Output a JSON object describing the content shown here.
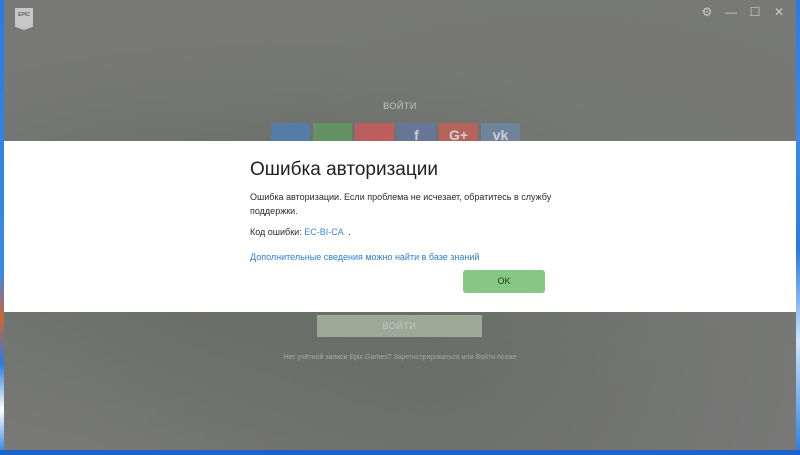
{
  "app": {
    "logo_text": "EPIC",
    "controls": [
      "⚙",
      "—",
      "☐",
      "✕"
    ]
  },
  "background": {
    "login_heading": "ВОЙТИ",
    "social_icons": [
      "playstation-icon",
      "xbox-icon",
      "nintendo-switch-icon",
      "facebook-icon",
      "google-plus-icon",
      "vk-icon"
    ],
    "social_labels": [
      "",
      "",
      "",
      "f",
      "G+",
      "vk"
    ],
    "social_colors": [
      "#1f67b8",
      "#3c8f3a",
      "#d9302c",
      "#3c5b98",
      "#cf3a2d",
      "#4d76a1"
    ],
    "login_button": "ВОЙТИ",
    "no_account": "Нет учётной записи Epic Games?",
    "signup_link": "Зарегистрироваться",
    "or": "или",
    "later_link": "Войти позже"
  },
  "dialog": {
    "title": "Ошибка авторизации",
    "message": "Ошибка авторизации. Если проблема не исчезает, обратитесь в службу поддержки.",
    "code_label": "Код ошибки:",
    "code_value": "EC-BI-CA",
    "code_suffix": ".",
    "knowledge_link": "Дополнительные сведения можно найти в базе знаний",
    "ok_button": "OK"
  }
}
